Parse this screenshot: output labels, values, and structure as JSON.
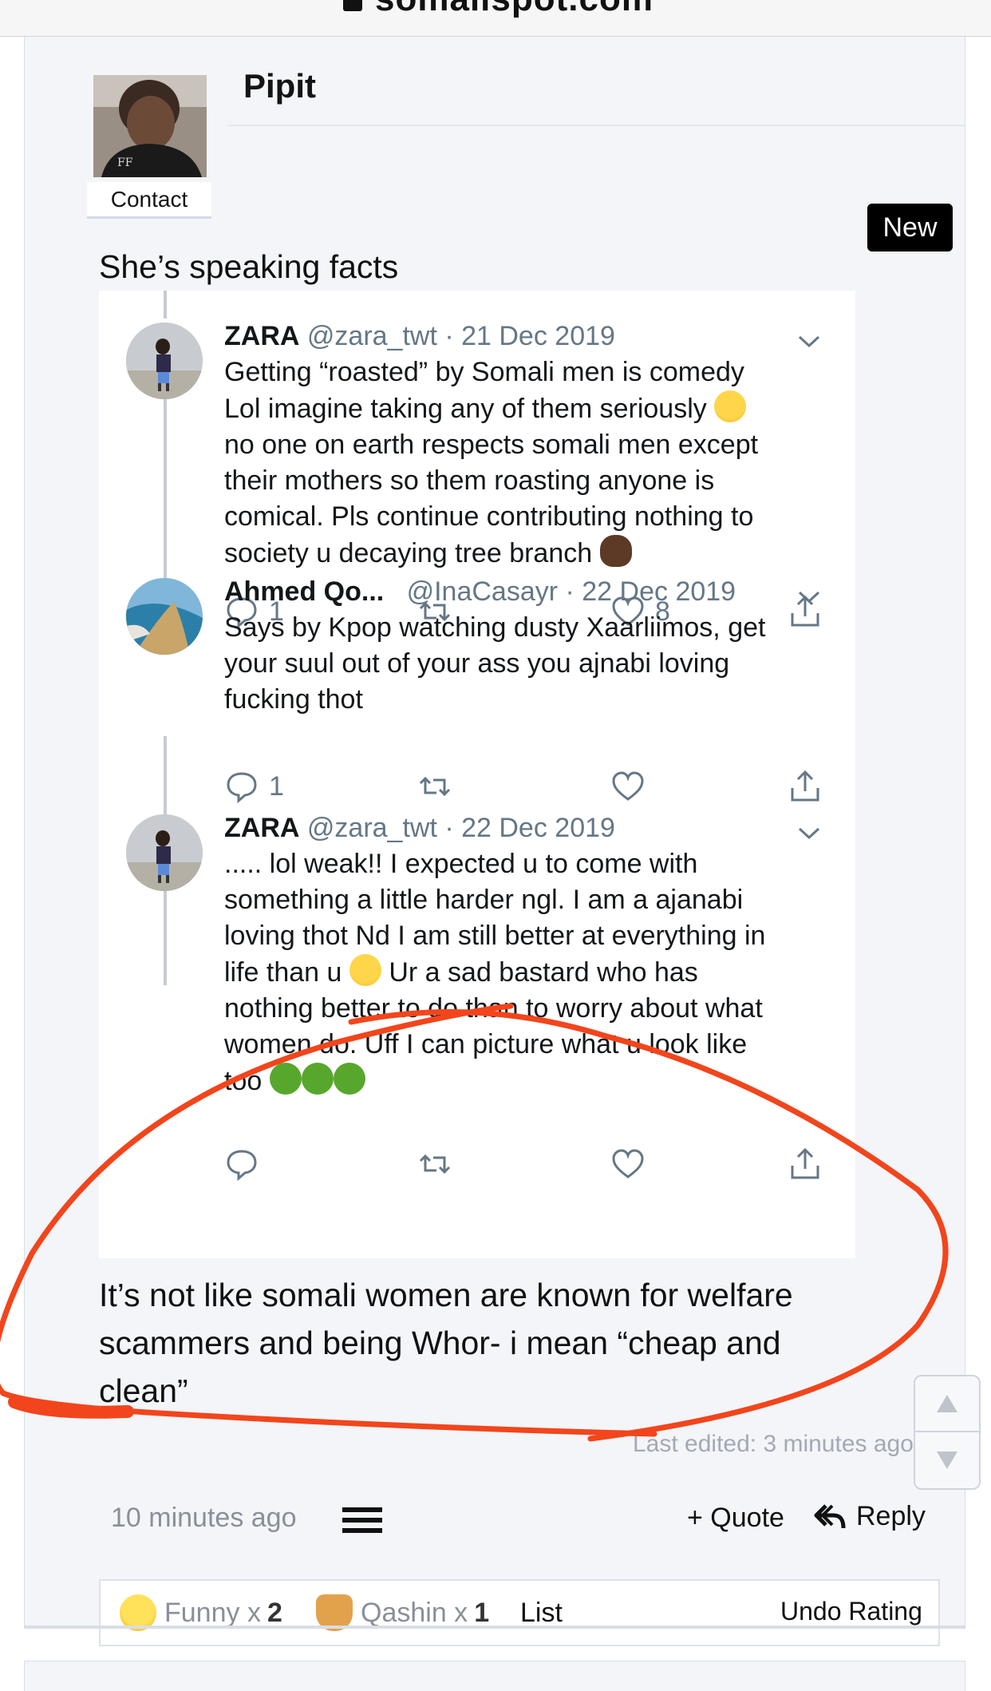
{
  "browser": {
    "url": "somalispot.com"
  },
  "post": {
    "username": "Pipit",
    "contact_label": "Contact",
    "badge_label": "New",
    "text_before": "She’s speaking facts",
    "text_after": "It’s not like somali women are known for welfare scammers and being Whor- i mean “cheap and clean”",
    "edited_note": "Last edited: 3 minutes ago",
    "posted_time": "10 minutes ago",
    "quote_label": "+ Quote",
    "reply_label": "Reply"
  },
  "tweets": [
    {
      "name": "ZARA",
      "handle": "@zara_twt · 21 Dec 2019",
      "lines": [
        "Getting “roasted” by Somali men is comedy",
        "Lol imagine taking any of them seriously",
        "no one on earth respects somali men except",
        "their mothers so them roasting anyone is",
        "comical. Pls continue contributing nothing to",
        "society u decaying tree branch"
      ],
      "replies": "1",
      "likes": "8"
    },
    {
      "name": "Ahmed Qo...",
      "handle": "@InaCasayr · 22 Dec 2019",
      "lines": [
        "Says by Kpop watching dusty Xaarliimos, get",
        "your suul out of your ass you ajnabi loving",
        "fucking thot"
      ],
      "replies": "1",
      "likes": ""
    },
    {
      "name": "ZARA",
      "handle": "@zara_twt · 22 Dec 2019",
      "lines": [
        "..... lol weak!! I expected u to come with",
        "something a little harder ngl. I am a ajanabi",
        "loving thot Nd I am still better at everything in",
        "life than u",
        "Ur a sad bastard who has",
        "nothing better to do than to worry about what",
        "women do. Uff I can picture what u look like",
        "too"
      ],
      "replies": "",
      "likes": ""
    }
  ],
  "reactions": {
    "funny_label": "Funny x",
    "funny_count": "2",
    "qashin_label": "Qashin x",
    "qashin_count": "1",
    "list_label": "List",
    "undo_label": "Undo Rating"
  },
  "icons": [
    "lock-icon",
    "menu-icon",
    "reply-arrow-icon",
    "comment-icon",
    "retweet-icon",
    "heart-icon",
    "share-icon",
    "chevron-down-icon",
    "scroll-up-icon",
    "scroll-down-icon"
  ],
  "colors": {
    "annotation_red": "#f2451c",
    "badge_bg": "#000000",
    "tweet_gray": "#657786"
  }
}
